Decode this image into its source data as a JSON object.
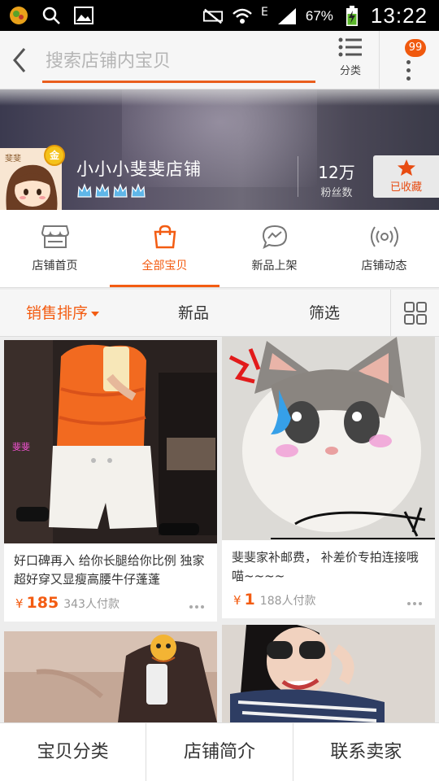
{
  "status_bar": {
    "battery_percent": "67%",
    "time": "13:22",
    "network_letter": "E",
    "icons": [
      "app-notification-icon",
      "search-icon",
      "image-icon",
      "mute-icon",
      "wifi-icon",
      "signal-icon",
      "battery-icon"
    ]
  },
  "header": {
    "search_placeholder": "搜索店铺内宝贝",
    "category_label": "分类",
    "badge_count": "99"
  },
  "shop": {
    "name": "小小小斐斐店铺",
    "fans_count": "12万",
    "fans_label": "粉丝数",
    "favorite_label": "已收藏",
    "gold_badge": "金",
    "crown_count": 4
  },
  "tabs": [
    {
      "label": "店铺首页",
      "icon": "store-icon",
      "active": false
    },
    {
      "label": "全部宝贝",
      "icon": "shopping-bag-icon",
      "active": true
    },
    {
      "label": "新品上架",
      "icon": "new-arrival-icon",
      "active": false
    },
    {
      "label": "店铺动态",
      "icon": "broadcast-icon",
      "active": false
    }
  ],
  "sort_bar": {
    "sales_sort": "销售排序",
    "new": "新品",
    "filter": "筛选"
  },
  "products": [
    {
      "title": "好口碑再入 给你长腿给你比例 独家超好穿又显瘦高腰牛仔蓬蓬",
      "currency": "¥",
      "price": "185",
      "sold": "343人付款"
    },
    {
      "title": "斐斐家补邮费， 补差价专拍连接哦 喵~~~~",
      "currency": "¥",
      "price": "1",
      "sold": "188人付款"
    },
    {
      "title": "",
      "currency": "",
      "price": "",
      "sold": ""
    },
    {
      "title": "",
      "currency": "",
      "price": "",
      "sold": ""
    }
  ],
  "bottom_bar": {
    "category": "宝贝分类",
    "intro": "店铺简介",
    "contact": "联系卖家"
  },
  "colors": {
    "accent": "#f35c12",
    "status_bar": "#000000",
    "badge": "#f0590e"
  }
}
